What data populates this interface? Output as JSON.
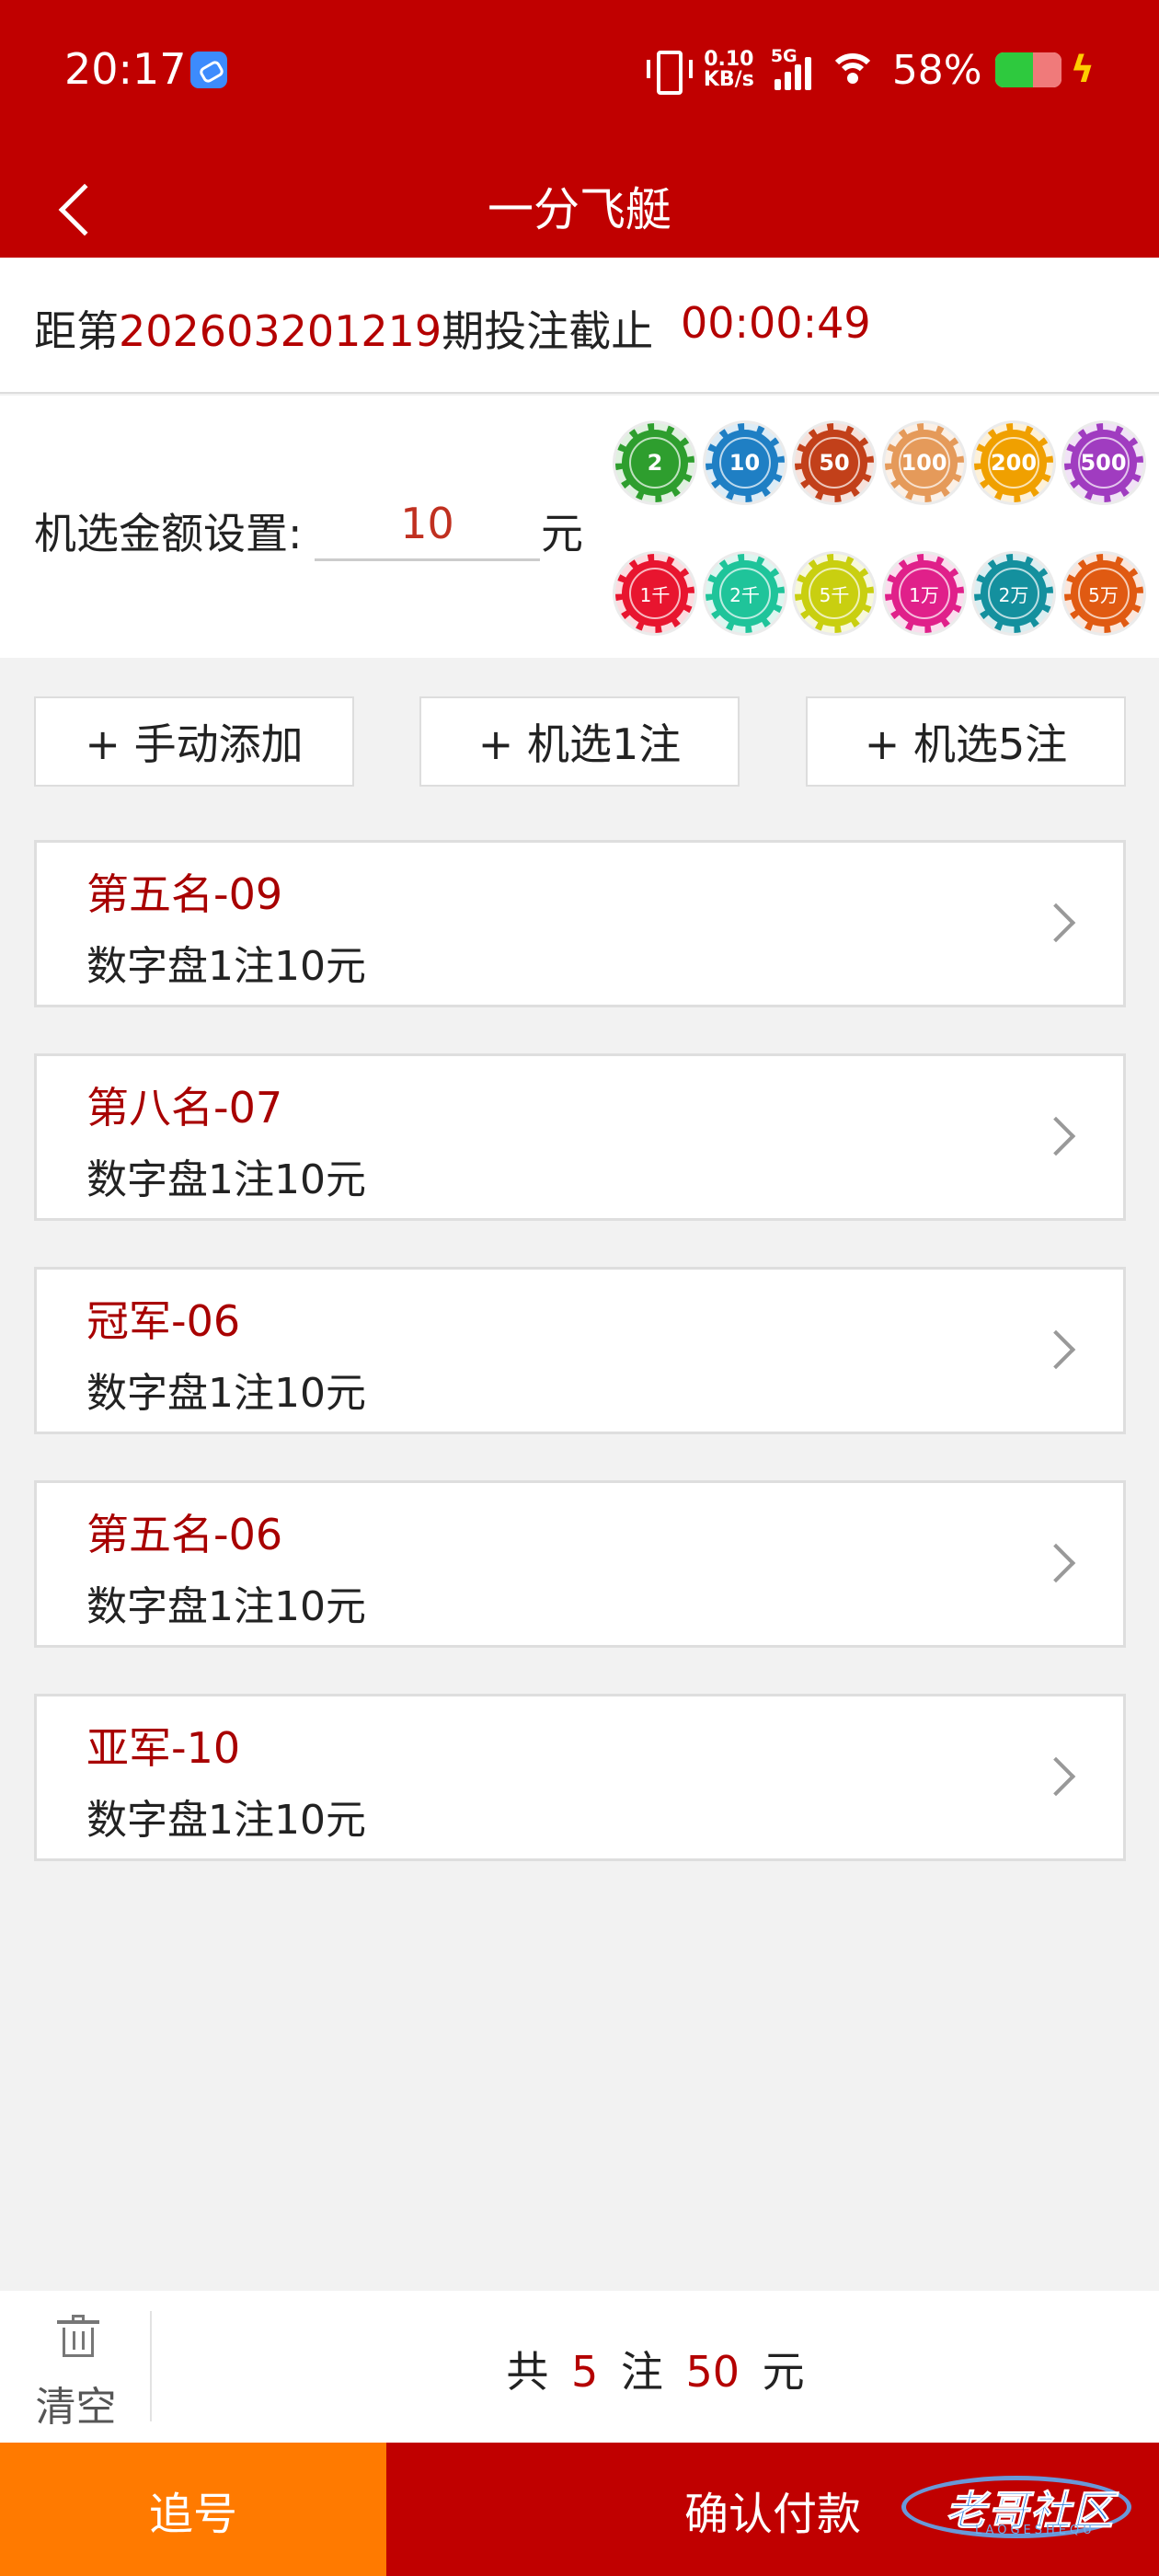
{
  "status_bar": {
    "time": "20:17",
    "net_speed_value": "0.10",
    "net_speed_unit": "KB/s",
    "network_type": "5G",
    "battery_percent": "58%",
    "battery_level": 0.58,
    "icons": [
      "app-notification-icon",
      "vibrate-icon",
      "signal-icon",
      "wifi-icon",
      "battery-icon",
      "charging-bolt-icon"
    ]
  },
  "header": {
    "title": "一分飞艇",
    "back_icon": "chevron-left-icon"
  },
  "deadline": {
    "prefix": "距第",
    "period": "202603201219",
    "suffix": "期投注截止",
    "countdown": "00:00:49"
  },
  "amount": {
    "label": "机选金额设置:",
    "value": "10",
    "unit": "元",
    "chips_row1": [
      "2",
      "10",
      "50",
      "100",
      "200",
      "500"
    ],
    "chips_row2": [
      "1千",
      "2千",
      "5千",
      "1万",
      "2万",
      "5万"
    ],
    "chip_colors_row1": [
      "#2e9e2e",
      "#1f7fc4",
      "#c2401a",
      "#e59a5a",
      "#f0a000",
      "#a03cc0"
    ],
    "chip_colors_row2": [
      "#e8152f",
      "#1fc49a",
      "#c9cf10",
      "#e0208a",
      "#14909e",
      "#e05a12"
    ]
  },
  "actions": {
    "manual_add": "+ 手动添加",
    "random_1": "+ 机选1注",
    "random_5": "+ 机选5注"
  },
  "bets": [
    {
      "title": "第五名-09",
      "desc": "数字盘1注10元"
    },
    {
      "title": "第八名-07",
      "desc": "数字盘1注10元"
    },
    {
      "title": "冠军-06",
      "desc": "数字盘1注10元"
    },
    {
      "title": "第五名-06",
      "desc": "数字盘1注10元"
    },
    {
      "title": "亚军-10",
      "desc": "数字盘1注10元"
    }
  ],
  "summary": {
    "clear_label": "清空",
    "total_prefix": "共",
    "count": "5",
    "count_unit": "注",
    "amount": "50",
    "amount_unit": "元"
  },
  "footer": {
    "chase": "追号",
    "confirm": "确认付款"
  },
  "watermark": {
    "text": "老哥社区",
    "sub": "LAOGESHEQU"
  },
  "colors": {
    "brand_red": "#c00000",
    "accent_orange": "#ff7a00",
    "text_red": "#b40000"
  }
}
